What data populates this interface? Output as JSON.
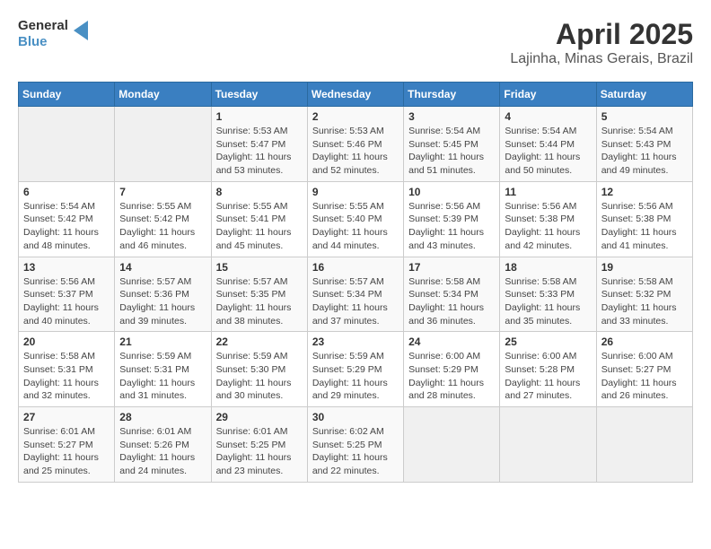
{
  "header": {
    "logo_line1": "General",
    "logo_line2": "Blue",
    "title": "April 2025",
    "subtitle": "Lajinha, Minas Gerais, Brazil"
  },
  "calendar": {
    "days_of_week": [
      "Sunday",
      "Monday",
      "Tuesday",
      "Wednesday",
      "Thursday",
      "Friday",
      "Saturday"
    ],
    "weeks": [
      [
        {
          "day": "",
          "info": ""
        },
        {
          "day": "",
          "info": ""
        },
        {
          "day": "1",
          "info": "Sunrise: 5:53 AM\nSunset: 5:47 PM\nDaylight: 11 hours and 53 minutes."
        },
        {
          "day": "2",
          "info": "Sunrise: 5:53 AM\nSunset: 5:46 PM\nDaylight: 11 hours and 52 minutes."
        },
        {
          "day": "3",
          "info": "Sunrise: 5:54 AM\nSunset: 5:45 PM\nDaylight: 11 hours and 51 minutes."
        },
        {
          "day": "4",
          "info": "Sunrise: 5:54 AM\nSunset: 5:44 PM\nDaylight: 11 hours and 50 minutes."
        },
        {
          "day": "5",
          "info": "Sunrise: 5:54 AM\nSunset: 5:43 PM\nDaylight: 11 hours and 49 minutes."
        }
      ],
      [
        {
          "day": "6",
          "info": "Sunrise: 5:54 AM\nSunset: 5:42 PM\nDaylight: 11 hours and 48 minutes."
        },
        {
          "day": "7",
          "info": "Sunrise: 5:55 AM\nSunset: 5:42 PM\nDaylight: 11 hours and 46 minutes."
        },
        {
          "day": "8",
          "info": "Sunrise: 5:55 AM\nSunset: 5:41 PM\nDaylight: 11 hours and 45 minutes."
        },
        {
          "day": "9",
          "info": "Sunrise: 5:55 AM\nSunset: 5:40 PM\nDaylight: 11 hours and 44 minutes."
        },
        {
          "day": "10",
          "info": "Sunrise: 5:56 AM\nSunset: 5:39 PM\nDaylight: 11 hours and 43 minutes."
        },
        {
          "day": "11",
          "info": "Sunrise: 5:56 AM\nSunset: 5:38 PM\nDaylight: 11 hours and 42 minutes."
        },
        {
          "day": "12",
          "info": "Sunrise: 5:56 AM\nSunset: 5:38 PM\nDaylight: 11 hours and 41 minutes."
        }
      ],
      [
        {
          "day": "13",
          "info": "Sunrise: 5:56 AM\nSunset: 5:37 PM\nDaylight: 11 hours and 40 minutes."
        },
        {
          "day": "14",
          "info": "Sunrise: 5:57 AM\nSunset: 5:36 PM\nDaylight: 11 hours and 39 minutes."
        },
        {
          "day": "15",
          "info": "Sunrise: 5:57 AM\nSunset: 5:35 PM\nDaylight: 11 hours and 38 minutes."
        },
        {
          "day": "16",
          "info": "Sunrise: 5:57 AM\nSunset: 5:34 PM\nDaylight: 11 hours and 37 minutes."
        },
        {
          "day": "17",
          "info": "Sunrise: 5:58 AM\nSunset: 5:34 PM\nDaylight: 11 hours and 36 minutes."
        },
        {
          "day": "18",
          "info": "Sunrise: 5:58 AM\nSunset: 5:33 PM\nDaylight: 11 hours and 35 minutes."
        },
        {
          "day": "19",
          "info": "Sunrise: 5:58 AM\nSunset: 5:32 PM\nDaylight: 11 hours and 33 minutes."
        }
      ],
      [
        {
          "day": "20",
          "info": "Sunrise: 5:58 AM\nSunset: 5:31 PM\nDaylight: 11 hours and 32 minutes."
        },
        {
          "day": "21",
          "info": "Sunrise: 5:59 AM\nSunset: 5:31 PM\nDaylight: 11 hours and 31 minutes."
        },
        {
          "day": "22",
          "info": "Sunrise: 5:59 AM\nSunset: 5:30 PM\nDaylight: 11 hours and 30 minutes."
        },
        {
          "day": "23",
          "info": "Sunrise: 5:59 AM\nSunset: 5:29 PM\nDaylight: 11 hours and 29 minutes."
        },
        {
          "day": "24",
          "info": "Sunrise: 6:00 AM\nSunset: 5:29 PM\nDaylight: 11 hours and 28 minutes."
        },
        {
          "day": "25",
          "info": "Sunrise: 6:00 AM\nSunset: 5:28 PM\nDaylight: 11 hours and 27 minutes."
        },
        {
          "day": "26",
          "info": "Sunrise: 6:00 AM\nSunset: 5:27 PM\nDaylight: 11 hours and 26 minutes."
        }
      ],
      [
        {
          "day": "27",
          "info": "Sunrise: 6:01 AM\nSunset: 5:27 PM\nDaylight: 11 hours and 25 minutes."
        },
        {
          "day": "28",
          "info": "Sunrise: 6:01 AM\nSunset: 5:26 PM\nDaylight: 11 hours and 24 minutes."
        },
        {
          "day": "29",
          "info": "Sunrise: 6:01 AM\nSunset: 5:25 PM\nDaylight: 11 hours and 23 minutes."
        },
        {
          "day": "30",
          "info": "Sunrise: 6:02 AM\nSunset: 5:25 PM\nDaylight: 11 hours and 22 minutes."
        },
        {
          "day": "",
          "info": ""
        },
        {
          "day": "",
          "info": ""
        },
        {
          "day": "",
          "info": ""
        }
      ]
    ]
  }
}
